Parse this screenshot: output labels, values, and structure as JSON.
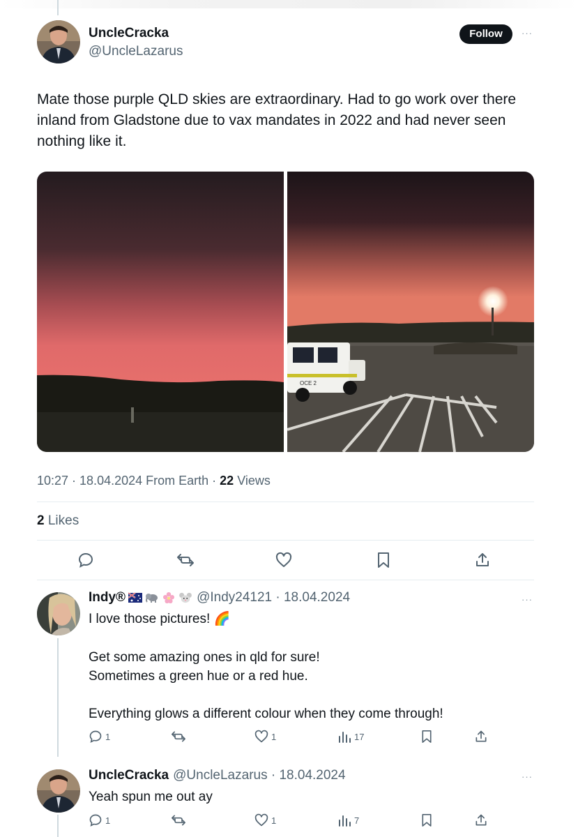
{
  "tweet": {
    "author_name": "UncleCracka",
    "author_handle": "@UncleLazarus",
    "follow_label": "Follow",
    "more_label": "···",
    "text": "Mate those purple QLD skies are extraordinary. Had to go work over there inland from Gladstone due to vax mandates in 2022 and had never seen nothing like it.",
    "timestamp": "10:27 · 18.04.2024 From Earth · ",
    "views_count": "22",
    "views_label": " Views",
    "likes_count": "2",
    "likes_label": " Likes"
  },
  "replies": [
    {
      "name": "Indy®",
      "emojis": [
        "australian-flag",
        "elephant",
        "cherry-blossom",
        "mouse-face"
      ],
      "meta": "@Indy24121 · 18.04.2024",
      "lines": [
        "I love those pictures! 🌈",
        "",
        "Get some amazing ones  in qld for sure!",
        "Sometimes a green hue or a red hue.",
        "",
        "Everything glows a different colour when they come through!"
      ],
      "reply_count": "1",
      "like_count": "1",
      "view_count": "17"
    },
    {
      "name": "UncleCracka",
      "meta": "@UncleLazarus · 18.04.2024",
      "lines": [
        "Yeah spun me out ay"
      ],
      "reply_count": "1",
      "like_count": "1",
      "view_count": "7"
    }
  ],
  "colors": {
    "text": "#0f1419",
    "secondary": "#536471",
    "divider": "#e6ecf0",
    "sky_red": "#d96a6a",
    "sky_dark": "#2a1c23"
  }
}
